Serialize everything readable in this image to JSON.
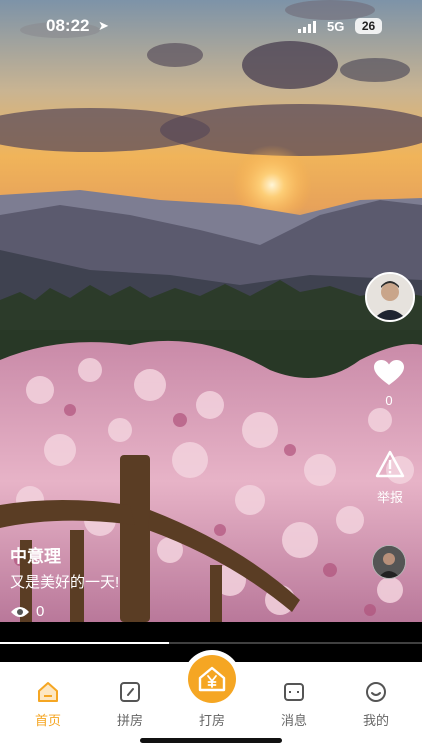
{
  "status_bar": {
    "time": "08:22",
    "network": "5G",
    "battery": "26"
  },
  "video": {
    "author": "中意理",
    "caption": "又是美好的一天!",
    "views": "0",
    "likes": "0",
    "report_label": "举报",
    "progress": 0.4
  },
  "tabs": [
    {
      "label": "首页",
      "icon": "home-icon",
      "active": true
    },
    {
      "label": "拼房",
      "icon": "edit-icon",
      "active": false
    },
    {
      "label": "打房",
      "icon": "house-yen-icon",
      "active": false
    },
    {
      "label": "消息",
      "icon": "message-icon",
      "active": false
    },
    {
      "label": "我的",
      "icon": "smile-icon",
      "active": false
    }
  ],
  "colors": {
    "accent": "#f5a623",
    "text": "#666666"
  }
}
